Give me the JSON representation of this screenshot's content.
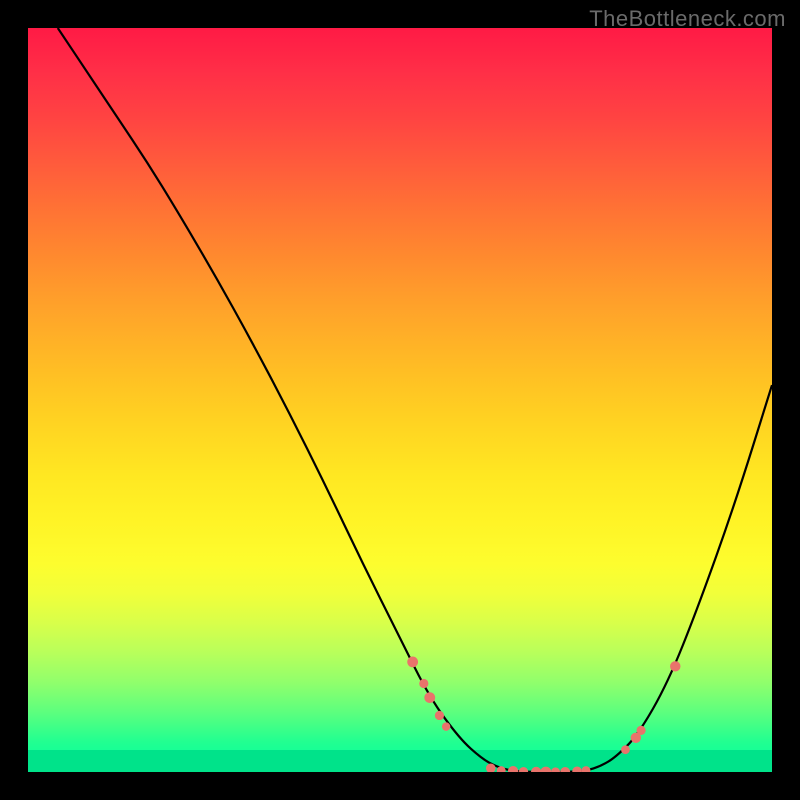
{
  "watermark": "TheBottleneck.com",
  "chart_data": {
    "type": "line",
    "title": "",
    "xlabel": "",
    "ylabel": "",
    "xlim": [
      0,
      100
    ],
    "ylim": [
      0,
      100
    ],
    "curve": [
      {
        "x": 4.0,
        "y": 100.0
      },
      {
        "x": 8.0,
        "y": 94.0
      },
      {
        "x": 12.0,
        "y": 88.0
      },
      {
        "x": 16.0,
        "y": 82.0
      },
      {
        "x": 20.0,
        "y": 75.5
      },
      {
        "x": 25.0,
        "y": 67.0
      },
      {
        "x": 30.0,
        "y": 58.0
      },
      {
        "x": 35.0,
        "y": 48.5
      },
      {
        "x": 40.0,
        "y": 38.5
      },
      {
        "x": 45.0,
        "y": 28.0
      },
      {
        "x": 50.0,
        "y": 18.0
      },
      {
        "x": 54.0,
        "y": 10.0
      },
      {
        "x": 58.0,
        "y": 4.5
      },
      {
        "x": 61.0,
        "y": 1.8
      },
      {
        "x": 63.0,
        "y": 0.7
      },
      {
        "x": 65.0,
        "y": 0.15
      },
      {
        "x": 68.0,
        "y": 0.0
      },
      {
        "x": 72.0,
        "y": 0.0
      },
      {
        "x": 75.0,
        "y": 0.15
      },
      {
        "x": 77.0,
        "y": 0.8
      },
      {
        "x": 79.0,
        "y": 2.0
      },
      {
        "x": 82.0,
        "y": 5.0
      },
      {
        "x": 86.0,
        "y": 12.0
      },
      {
        "x": 90.0,
        "y": 22.0
      },
      {
        "x": 95.0,
        "y": 36.0
      },
      {
        "x": 100.0,
        "y": 52.0
      }
    ],
    "markers": [
      {
        "x": 51.7,
        "y": 14.8,
        "r": 5.4
      },
      {
        "x": 53.2,
        "y": 11.9,
        "r": 4.6
      },
      {
        "x": 54.0,
        "y": 10.0,
        "r": 5.4
      },
      {
        "x": 55.3,
        "y": 7.6,
        "r": 4.6
      },
      {
        "x": 56.2,
        "y": 6.1,
        "r": 4.2
      },
      {
        "x": 62.2,
        "y": 0.5,
        "r": 4.8
      },
      {
        "x": 63.6,
        "y": 0.2,
        "r": 4.4
      },
      {
        "x": 65.2,
        "y": 0.1,
        "r": 5.2
      },
      {
        "x": 66.6,
        "y": 0.05,
        "r": 4.6
      },
      {
        "x": 68.3,
        "y": 0.0,
        "r": 5.2
      },
      {
        "x": 69.6,
        "y": 0.0,
        "r": 5.4
      },
      {
        "x": 70.9,
        "y": 0.0,
        "r": 4.6
      },
      {
        "x": 72.2,
        "y": 0.0,
        "r": 5.0
      },
      {
        "x": 73.8,
        "y": 0.1,
        "r": 4.8
      },
      {
        "x": 75.0,
        "y": 0.2,
        "r": 4.4
      },
      {
        "x": 80.3,
        "y": 3.0,
        "r": 4.4
      },
      {
        "x": 81.7,
        "y": 4.6,
        "r": 5.2
      },
      {
        "x": 82.4,
        "y": 5.6,
        "r": 4.6
      },
      {
        "x": 87.0,
        "y": 14.2,
        "r": 5.2
      }
    ],
    "colors": {
      "gradient_top": "#ff1a45",
      "gradient_bottom": "#00ffa0",
      "marker": "#e9736b",
      "curve": "#000000",
      "frame_bg": "#000000"
    }
  }
}
